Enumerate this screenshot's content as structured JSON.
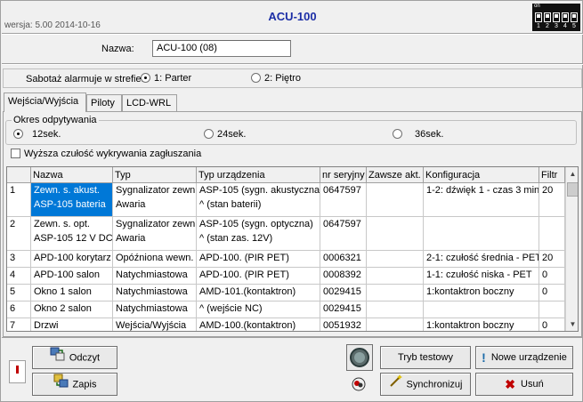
{
  "header": {
    "version": "wersja: 5.00 2014-10-16",
    "title": "ACU-100",
    "dip_on_label": "on",
    "dip_numbers": [
      "1",
      "2",
      "3",
      "4",
      "5"
    ]
  },
  "name_field": {
    "label": "Nazwa:",
    "value": "ACU-100     (08)"
  },
  "tamper": {
    "label": "Sabotaż alarmuje w strefie:",
    "options": [
      "1: Parter",
      "2: Piętro"
    ],
    "selected": "1: Parter"
  },
  "tabs": [
    "Wejścia/Wyjścia",
    "Piloty",
    "LCD-WRL"
  ],
  "polling": {
    "group_label": "Okres odpytywania",
    "options": [
      "12sek.",
      "24sek.",
      "36sek."
    ],
    "selected": "12sek."
  },
  "jamming": {
    "label": "Wyższa czułość wykrywania zagłuszania",
    "checked": false
  },
  "table": {
    "columns": [
      "",
      "Nazwa",
      "Typ",
      "Typ urządzenia",
      "nr seryjny",
      "Zawsze akt.",
      "Konfiguracja",
      "Filtr"
    ],
    "rows": [
      {
        "n": "1",
        "name": [
          "Zewn. s. akust.",
          "ASP-105 bateria"
        ],
        "type": [
          "Sygnalizator zewn.",
          "Awaria"
        ],
        "device": [
          "ASP-105 (sygn. akustyczna)",
          "^               (stan baterii)"
        ],
        "serial": "0647597",
        "always": "",
        "config": "1-2: dźwięk 1 - czas 3 min.",
        "filter": "20"
      },
      {
        "n": "2",
        "name": [
          "Zewn. s. opt.",
          "ASP-105 12 V DC"
        ],
        "type": [
          "Sygnalizator zewn.",
          "Awaria"
        ],
        "device": [
          "ASP-105 (sygn. optyczna)",
          "^               (stan zas. 12V)"
        ],
        "serial": "0647597",
        "always": "",
        "config": "",
        "filter": ""
      },
      {
        "n": "3",
        "name": [
          "APD-100 korytarz"
        ],
        "type": [
          "Opóźniona wewn."
        ],
        "device": [
          "APD-100. (PIR PET)"
        ],
        "serial": "0006321",
        "always": "",
        "config": "2-1: czułość średnia - PET",
        "filter": "20"
      },
      {
        "n": "4",
        "name": [
          "APD-100 salon"
        ],
        "type": [
          "Natychmiastowa"
        ],
        "device": [
          "APD-100. (PIR PET)"
        ],
        "serial": "0008392",
        "always": "",
        "config": "1-1: czułość niska - PET",
        "filter": "0"
      },
      {
        "n": "5",
        "name": [
          "Okno 1 salon"
        ],
        "type": [
          "Natychmiastowa"
        ],
        "device": [
          "AMD-101.(kontaktron)"
        ],
        "serial": "0029415",
        "always": "",
        "config": "1:kontaktron boczny",
        "filter": "0"
      },
      {
        "n": "6",
        "name": [
          "Okno 2 salon"
        ],
        "type": [
          "Natychmiastowa"
        ],
        "device": [
          "^               (wejście NC)"
        ],
        "serial": "0029415",
        "always": "",
        "config": "",
        "filter": ""
      },
      {
        "n": "7",
        "name": [
          "Drzwi"
        ],
        "type": [
          "Wejścia/Wyjścia"
        ],
        "device": [
          "AMD-100.(kontaktron)"
        ],
        "serial": "0051932",
        "always": "",
        "config": "1:kontaktron boczny",
        "filter": "0"
      }
    ]
  },
  "buttons": {
    "read": "Odczyt",
    "write": "Zapis",
    "test_mode": "Tryb testowy",
    "sync": "Synchronizuj",
    "new_device": "Nowe urządzenie",
    "delete": "Usuń"
  },
  "colors": {
    "title": "#1c2ea6",
    "selection": "#0078d7"
  }
}
